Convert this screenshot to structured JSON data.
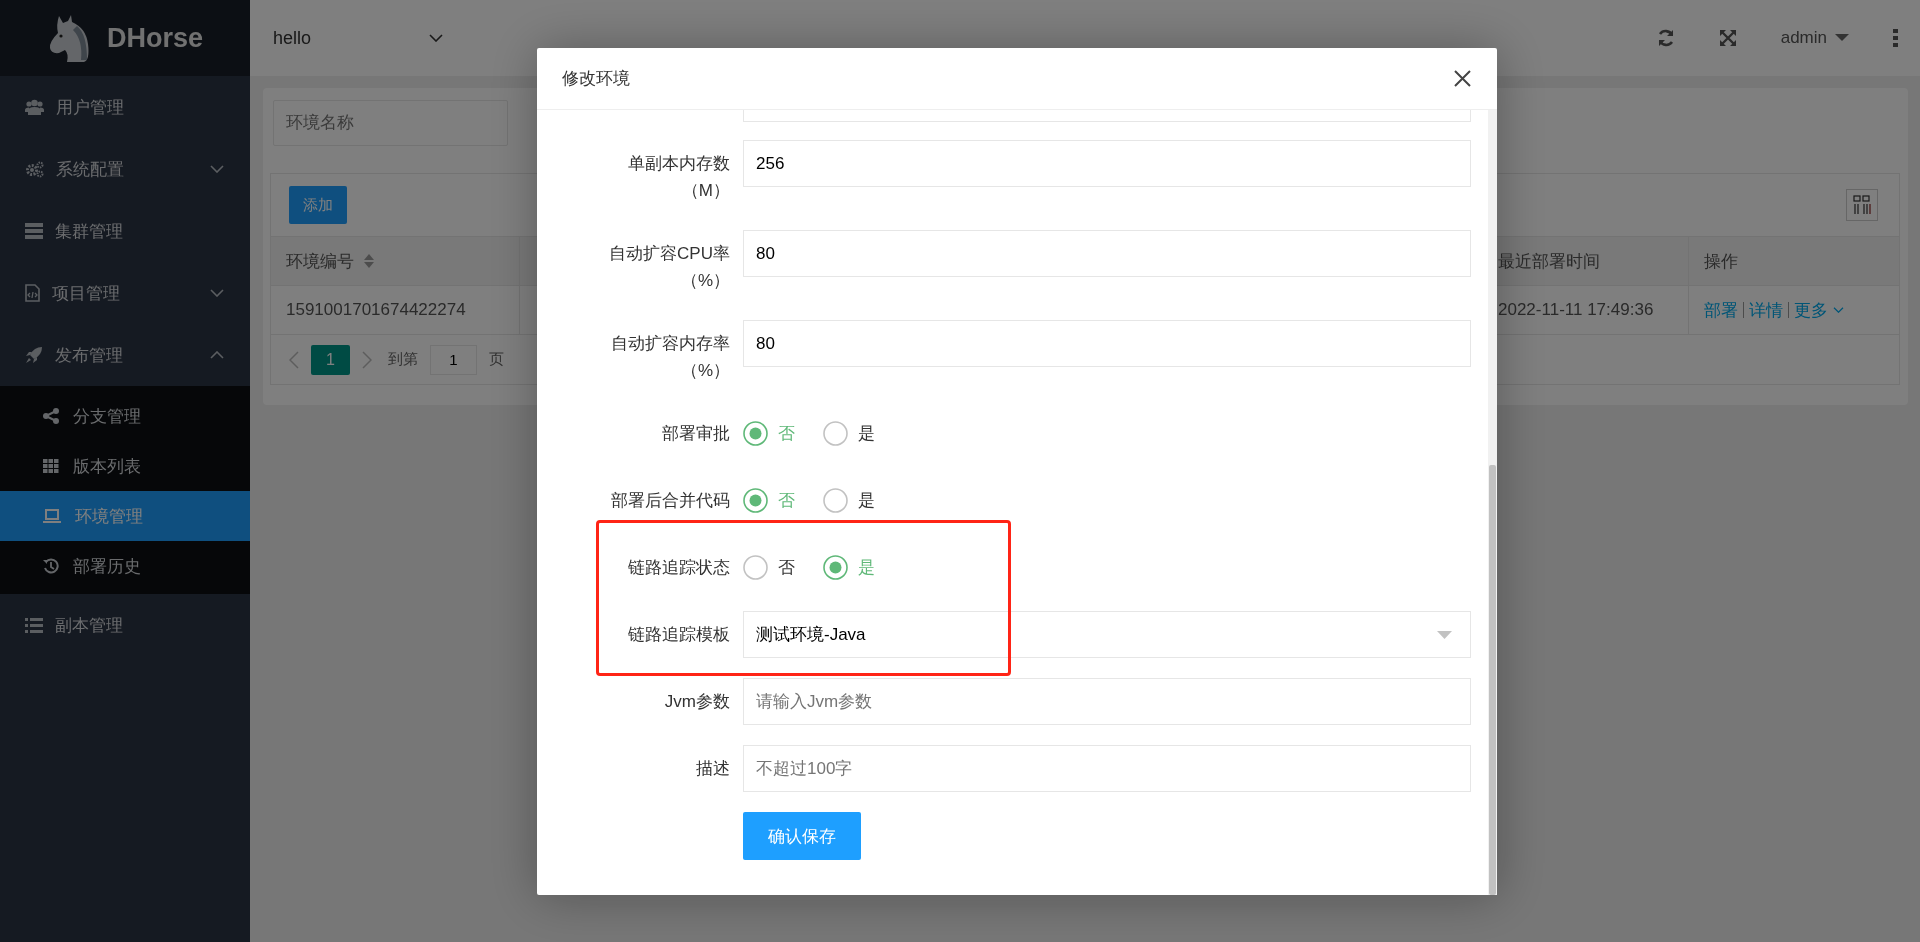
{
  "sidebar": {
    "logo": "DHorse",
    "items": [
      {
        "label": "用户管理",
        "selected": false
      },
      {
        "label": "系统配置",
        "selected": false,
        "expanded": false
      },
      {
        "label": "集群管理",
        "selected": false
      },
      {
        "label": "项目管理",
        "selected": false,
        "expanded": false
      },
      {
        "label": "发布管理",
        "selected": false,
        "expanded": true,
        "children": [
          {
            "label": "分支管理",
            "selected": false
          },
          {
            "label": "版本列表",
            "selected": false
          },
          {
            "label": "环境管理",
            "selected": true
          },
          {
            "label": "部署历史",
            "selected": false
          }
        ]
      },
      {
        "label": "副本管理",
        "selected": false
      }
    ]
  },
  "header": {
    "project": "hello",
    "user": "admin"
  },
  "search": {
    "placeholder": "环境名称"
  },
  "toolbar": {
    "add_button": "添加"
  },
  "table": {
    "columns": [
      {
        "label": "环境编号",
        "sortable": true
      },
      {
        "label": "最近部署时间",
        "sortable": false
      },
      {
        "label": "操作",
        "sortable": false
      }
    ],
    "rows": [
      {
        "cells": [
          "1591001701674422274",
          "2022-11-11 17:49:36"
        ],
        "actions": [
          "部署",
          "详情",
          "更多"
        ]
      }
    ]
  },
  "pagination": {
    "pages": [
      {
        "label": "1",
        "selected": true
      }
    ],
    "goto_label": "到第",
    "goto_value": "1",
    "page_suffix": "页"
  },
  "modal": {
    "title": "修改环境",
    "submit": "确认保存",
    "fields": [
      {
        "kind": "input",
        "label": "单副本内存数（M）",
        "value": "256",
        "highlighted": false
      },
      {
        "kind": "input",
        "label": "自动扩容CPU率（%）",
        "value": "80",
        "highlighted": false
      },
      {
        "kind": "input",
        "label": "自动扩容内存率（%）",
        "value": "80",
        "highlighted": false
      },
      {
        "kind": "radio",
        "label": "部署审批",
        "highlighted": false,
        "options": [
          {
            "label": "否",
            "selected": true
          },
          {
            "label": "是",
            "selected": false
          }
        ]
      },
      {
        "kind": "radio",
        "label": "部署后合并代码",
        "highlighted": false,
        "options": [
          {
            "label": "否",
            "selected": true
          },
          {
            "label": "是",
            "selected": false
          }
        ]
      },
      {
        "kind": "radio",
        "label": "链路追踪状态",
        "highlighted": true,
        "options": [
          {
            "label": "否",
            "selected": false
          },
          {
            "label": "是",
            "selected": true
          }
        ]
      },
      {
        "kind": "select",
        "label": "链路追踪模板",
        "value": "测试环境-Java",
        "highlighted": true
      },
      {
        "kind": "input",
        "label": "Jvm参数",
        "placeholder": "请输入Jvm参数",
        "highlighted": false
      },
      {
        "kind": "input",
        "label": "描述",
        "placeholder": "不超过100字",
        "highlighted": false
      }
    ]
  }
}
